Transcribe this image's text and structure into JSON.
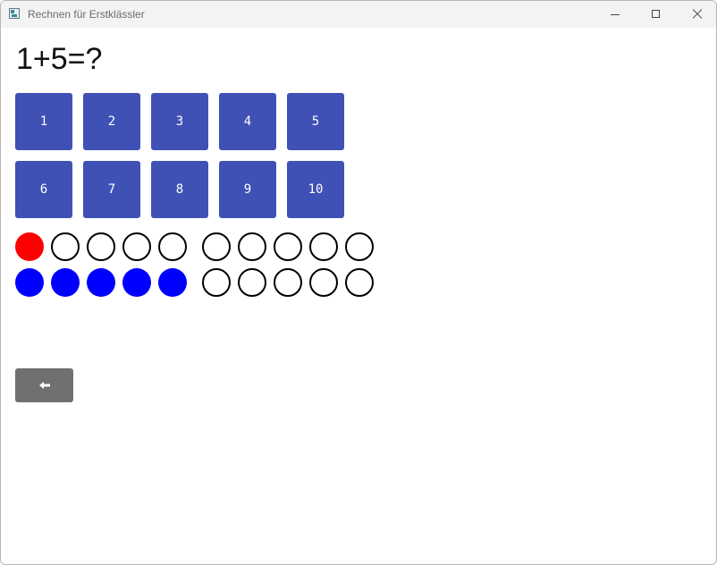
{
  "window": {
    "title": "Rechnen für Erstklässler"
  },
  "question": {
    "text": "1+5=?"
  },
  "answers": [
    {
      "label": "1"
    },
    {
      "label": "2"
    },
    {
      "label": "3"
    },
    {
      "label": "4"
    },
    {
      "label": "5"
    },
    {
      "label": "6"
    },
    {
      "label": "7"
    },
    {
      "label": "8"
    },
    {
      "label": "9"
    },
    {
      "label": "10"
    }
  ],
  "counters": {
    "first_row_filled": 1,
    "second_row_filled": 5,
    "dots_per_row": 10,
    "first_color": "#ff0000",
    "second_color": "#0000ff",
    "empty_stroke": "#000000"
  },
  "icons": {
    "back": "left-arrow-icon"
  },
  "colors": {
    "answer_button": "#3f51b5",
    "back_button": "#707070"
  }
}
